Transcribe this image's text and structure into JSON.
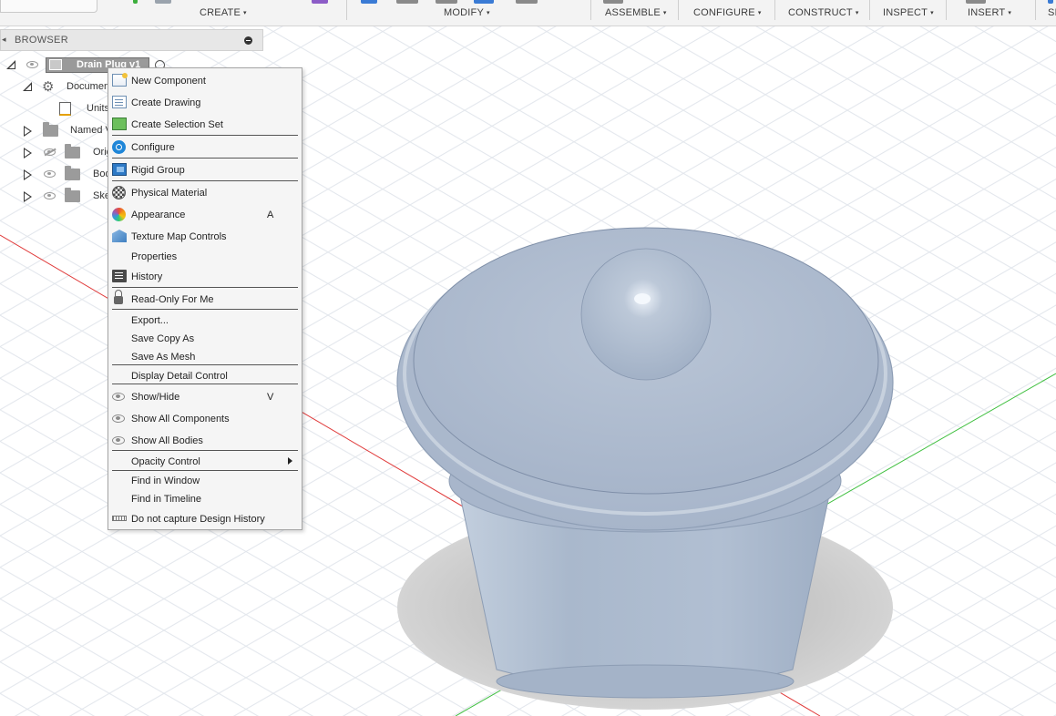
{
  "toolbar": {
    "groups": [
      {
        "label": "CREATE",
        "caret": "▾"
      },
      {
        "label": "MODIFY",
        "caret": "▾"
      },
      {
        "label": "ASSEMBLE",
        "caret": "▾"
      },
      {
        "label": "CONFIGURE",
        "caret": "▾"
      },
      {
        "label": "CONSTRUCT",
        "caret": "▾"
      },
      {
        "label": "INSPECT",
        "caret": "▾"
      },
      {
        "label": "INSERT",
        "caret": "▾"
      },
      {
        "label": "SI"
      }
    ]
  },
  "browser": {
    "title": "BROWSER",
    "collapse_glyph": "◂",
    "tree": [
      {
        "label": "Drain Plug v1",
        "icon": "component-icon",
        "visible": true
      },
      {
        "label": "Document Settings",
        "icon": "gear-icon"
      },
      {
        "label": "Units",
        "icon": "document-icon"
      },
      {
        "label": "Named Views",
        "icon": "folder-icon"
      },
      {
        "label": "Origin",
        "icon": "folder-icon",
        "visible": false
      },
      {
        "label": "Bodies",
        "icon": "folder-icon",
        "visible": true
      },
      {
        "label": "Sketches",
        "icon": "folder-icon",
        "visible": true
      }
    ]
  },
  "context_menu": {
    "items": [
      {
        "label": "New Component",
        "icon": "new-component-icon"
      },
      {
        "label": "Create Drawing",
        "icon": "create-drawing-icon"
      },
      {
        "label": "Create Selection Set",
        "icon": "selection-set-icon"
      },
      {
        "label": "Configure",
        "icon": "configure-icon"
      },
      {
        "label": "Rigid Group",
        "icon": "rigid-group-icon"
      },
      {
        "label": "Physical Material",
        "icon": "physical-material-icon"
      },
      {
        "label": "Appearance",
        "icon": "appearance-icon",
        "shortcut": "A"
      },
      {
        "label": "Texture Map Controls",
        "icon": "texture-map-icon"
      },
      {
        "label": "Properties"
      },
      {
        "label": "History",
        "icon": "history-icon"
      },
      {
        "label": "Read-Only For Me",
        "icon": "lock-icon"
      },
      {
        "label": "Export..."
      },
      {
        "label": "Save Copy As"
      },
      {
        "label": "Save As Mesh"
      },
      {
        "label": "Display Detail Control"
      },
      {
        "label": "Show/Hide",
        "icon": "eye-icon",
        "shortcut": "V"
      },
      {
        "label": "Show All Components",
        "icon": "eye-icon"
      },
      {
        "label": "Show All Bodies",
        "icon": "eye-icon"
      },
      {
        "label": "Opacity Control",
        "submenu": true
      },
      {
        "label": "Find in Window"
      },
      {
        "label": "Find in Timeline"
      },
      {
        "label": "Do not capture Design History",
        "icon": "capture-history-icon"
      }
    ]
  },
  "colors": {
    "model_body": "#aebbd0",
    "grid_line": "#e2e6ec",
    "axis_x": "#e03a3a",
    "axis_y": "#3fbf3f",
    "menu_bg": "#f5f5f5",
    "toolbar_bg": "#f3f3f3"
  }
}
